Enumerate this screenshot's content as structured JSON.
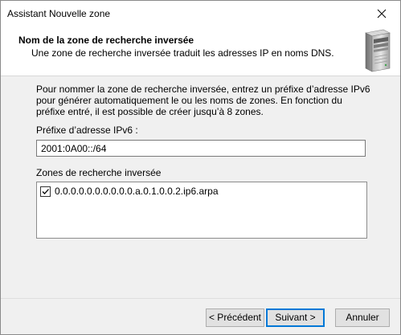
{
  "window": {
    "title": "Assistant Nouvelle zone"
  },
  "header": {
    "title": "Nom de la zone de recherche inversée",
    "subtitle": "Une zone de recherche inversée traduit les adresses IP en noms DNS.",
    "icon": "server-icon"
  },
  "body": {
    "description": "Pour nommer la zone de recherche inversée, entrez un préfixe d’adresse IPv6 pour générer automatiquement le ou les noms de zones. En fonction du préfixe entré, il est possible de créer jusqu’à 8 zones.",
    "prefix_label": "Préfixe d’adresse IPv6 :",
    "prefix_value": "2001:0A00::/64",
    "zones_label": "Zones de recherche inversée",
    "zones": [
      {
        "checked": true,
        "name": "0.0.0.0.0.0.0.0.0.0.a.0.1.0.0.2.ip6.arpa"
      }
    ]
  },
  "buttons": {
    "previous": "< Précédent",
    "next": "Suivant >",
    "cancel": "Annuler"
  },
  "colors": {
    "accent": "#0078d7",
    "header_bg": "#ffffff",
    "body_bg": "#f0f0f0"
  }
}
